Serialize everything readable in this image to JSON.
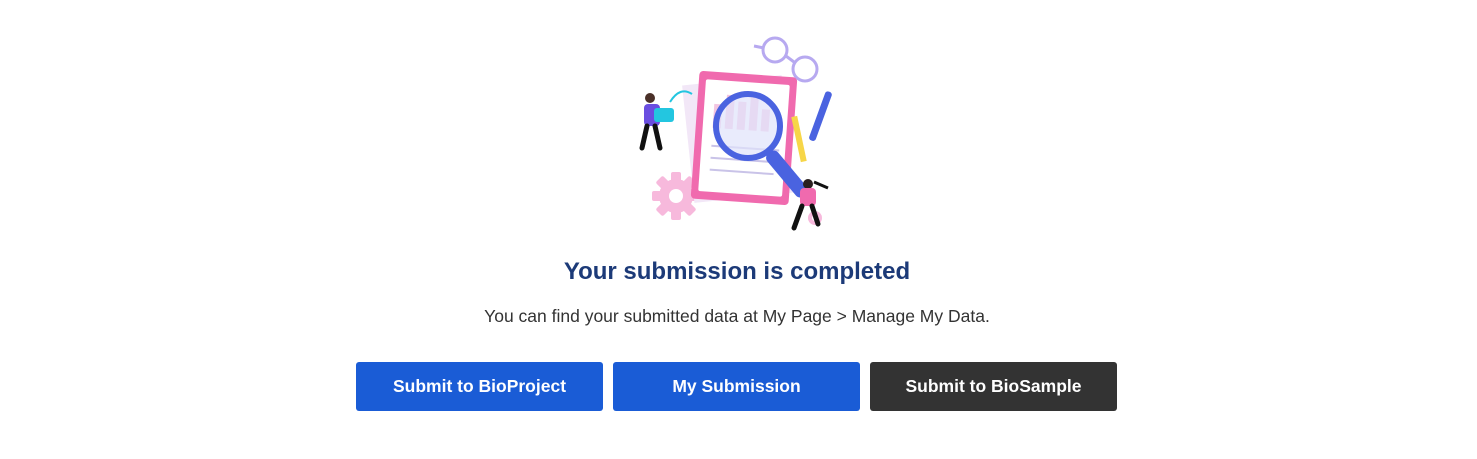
{
  "completion": {
    "title": "Your submission is completed",
    "message": "You can find your submitted data at My Page > Manage My Data."
  },
  "actions": [
    {
      "label": "Submit to BioProject"
    },
    {
      "label": "My Submission"
    },
    {
      "label": "Submit to BioSample"
    }
  ],
  "illustration": {
    "icon": "document-search-illustration"
  },
  "colors": {
    "title": "#1c3a78",
    "primary_button": "#1a5cd6",
    "dark_button": "#333333",
    "accent_pink": "#f06aae",
    "accent_blue": "#4a63e0"
  }
}
